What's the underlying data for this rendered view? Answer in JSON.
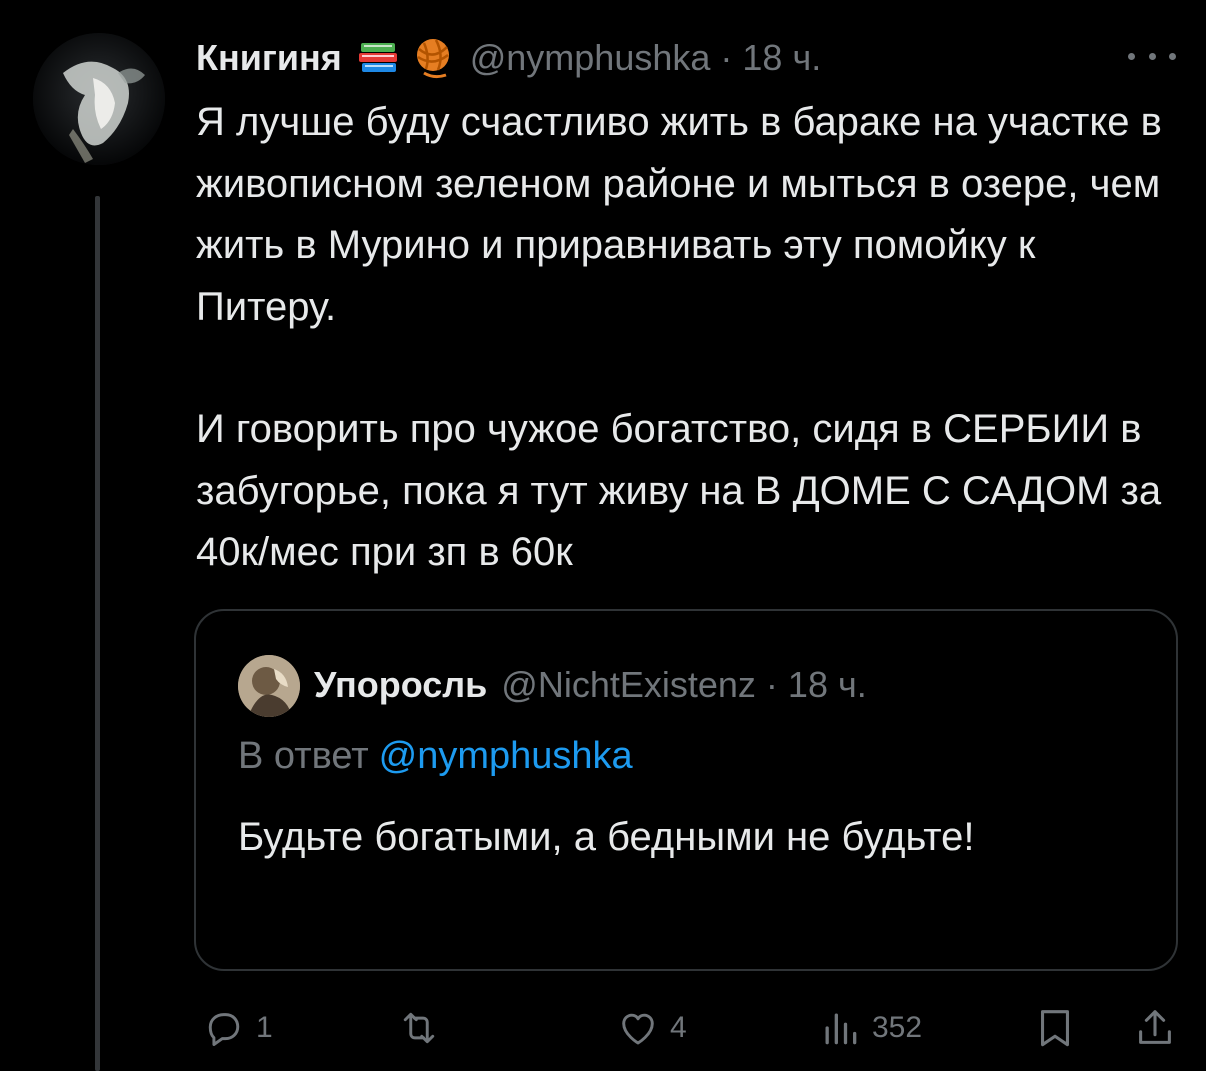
{
  "tweet": {
    "display_name": "Книгиня",
    "emojis": [
      "books-emoji",
      "yarn-emoji"
    ],
    "handle": "@nymphushka",
    "time": "18 ч.",
    "paragraphs": [
      "Я лучше буду счастливо жить в бараке на участке в живописном зеленом районе и мыться в озере, чем жить в Мурино и приравнивать эту помойку к Питеру.",
      "И говорить про чужое богатство, сидя в СЕРБИИ в забугорье, пока я тут живу на В ДОМЕ С САДОМ за 40к/мес при зп в 60к"
    ]
  },
  "quote": {
    "display_name": "Упоросль",
    "handle": "@NichtExistenz",
    "time": "18 ч.",
    "reply_prefix": "В ответ",
    "reply_mention": "@nymphushka",
    "text": "Будьте богатыми, а бедными не будьте!"
  },
  "actions": {
    "replies": "1",
    "retweets": "",
    "likes": "4",
    "views": "352"
  },
  "colors": {
    "background": "#000000",
    "text": "#e7e9ea",
    "secondary": "#71767b",
    "accent": "#1d9bf0",
    "border": "#2f3336"
  }
}
